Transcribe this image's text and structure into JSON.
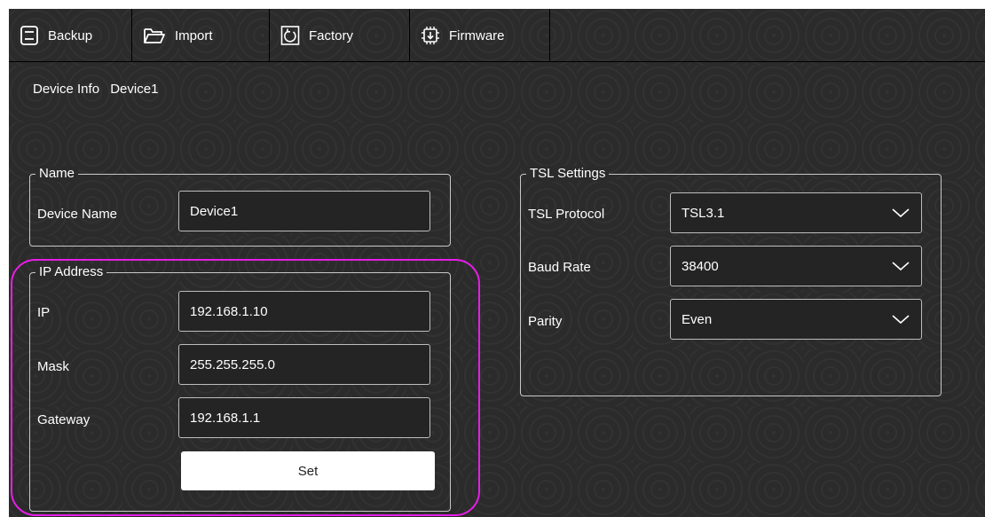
{
  "toolbar": {
    "tabs": [
      {
        "label": "Backup",
        "icon": "save-icon"
      },
      {
        "label": "Import",
        "icon": "folder-open-icon"
      },
      {
        "label": "Factory",
        "icon": "reset-icon"
      },
      {
        "label": "Firmware",
        "icon": "chip-icon"
      }
    ]
  },
  "device_info": {
    "label": "Device Info",
    "value": "Device1"
  },
  "name_group": {
    "title": "Name",
    "device_name_label": "Device Name",
    "device_name_value": "Device1"
  },
  "ip_group": {
    "title": "IP Address",
    "ip_label": "IP",
    "ip_value": "192.168.1.10",
    "mask_label": "Mask",
    "mask_value": "255.255.255.0",
    "gateway_label": "Gateway",
    "gateway_value": "192.168.1.1",
    "set_label": "Set"
  },
  "tsl_group": {
    "title": "TSL Settings",
    "protocol_label": "TSL Protocol",
    "protocol_value": "TSL3.1",
    "baud_label": "Baud Rate",
    "baud_value": "38400",
    "parity_label": "Parity",
    "parity_value": "Even"
  },
  "colors": {
    "background": "#2b2b2b",
    "highlight": "#e81de8",
    "border": "#c8c8c8"
  }
}
